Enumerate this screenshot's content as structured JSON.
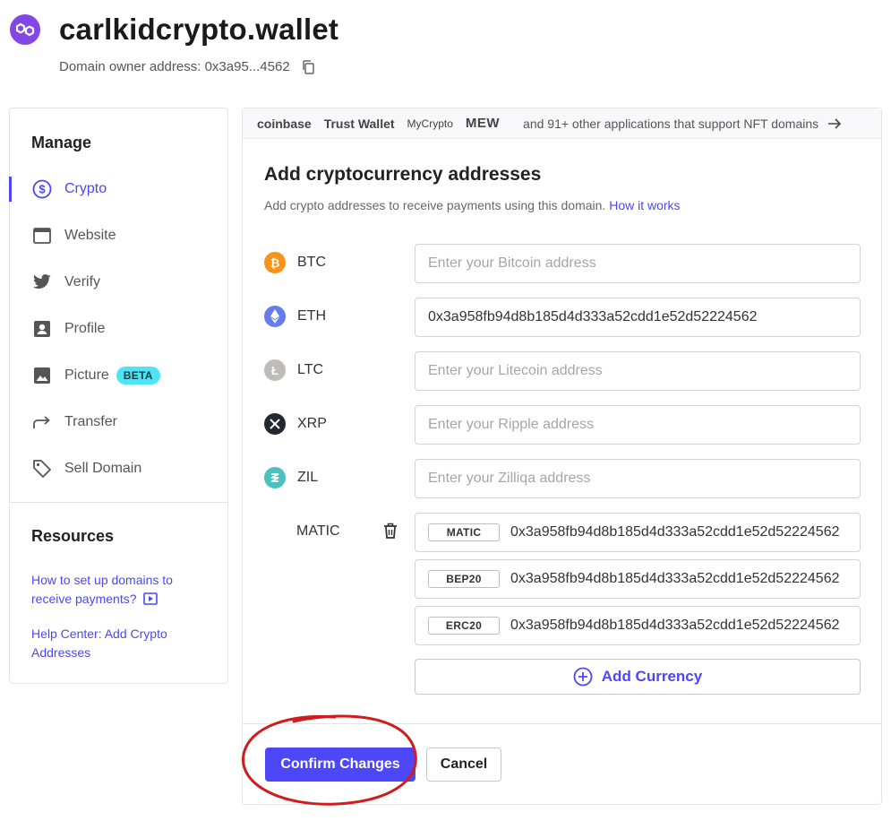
{
  "header": {
    "domain": "carlkidcrypto.wallet",
    "owner_label": "Domain owner address: 0x3a95...4562"
  },
  "sidebar": {
    "manage_title": "Manage",
    "items": [
      {
        "label": "Crypto",
        "icon": "dollar-circle-icon",
        "active": true
      },
      {
        "label": "Website",
        "icon": "browser-window-icon"
      },
      {
        "label": "Verify",
        "icon": "twitter-bird-icon"
      },
      {
        "label": "Profile",
        "icon": "profile-card-icon"
      },
      {
        "label": "Picture",
        "icon": "image-icon",
        "badge": "BETA"
      },
      {
        "label": "Transfer",
        "icon": "forward-arrow-icon"
      },
      {
        "label": "Sell Domain",
        "icon": "price-tag-icon"
      }
    ],
    "resources_title": "Resources",
    "resources": [
      "How to set up domains to receive payments?",
      "Help Center: Add Crypto Addresses"
    ]
  },
  "apps_bar": {
    "apps": [
      "coinbase",
      "Trust Wallet",
      "MyCrypto",
      "MEW"
    ],
    "more": "and 91+ other applications that support NFT domains"
  },
  "main": {
    "title": "Add cryptocurrency addresses",
    "subtitle": "Add crypto addresses to receive payments using this domain.",
    "how_link": "How it works",
    "currencies": [
      {
        "ticker": "BTC",
        "value": "",
        "placeholder": "Enter your Bitcoin address",
        "color": "#f7931a"
      },
      {
        "ticker": "ETH",
        "value": "0x3a958fb94d8b185d4d333a52cdd1e52d52224562",
        "placeholder": "",
        "color": "#627eea"
      },
      {
        "ticker": "LTC",
        "value": "",
        "placeholder": "Enter your Litecoin address",
        "color": "#bfbbbb"
      },
      {
        "ticker": "XRP",
        "value": "",
        "placeholder": "Enter your Ripple address",
        "color": "#23292f"
      },
      {
        "ticker": "ZIL",
        "value": "",
        "placeholder": "Enter your Zilliqa address",
        "color": "#49c1bf"
      }
    ],
    "matic": {
      "ticker": "MATIC",
      "chains": [
        {
          "tag": "MATIC",
          "value": "0x3a958fb94d8b185d4d333a52cdd1e52d52224562"
        },
        {
          "tag": "BEP20",
          "value": "0x3a958fb94d8b185d4d333a52cdd1e52d52224562"
        },
        {
          "tag": "ERC20",
          "value": "0x3a958fb94d8b185d4d333a52cdd1e52d52224562"
        }
      ]
    },
    "add_currency": "Add Currency",
    "confirm": "Confirm Changes",
    "cancel": "Cancel"
  },
  "colors": {
    "accent": "#4c47f7",
    "logo": "#8247e5",
    "beta_badge": "#4de4f5",
    "annotation": "#d01c1c"
  }
}
